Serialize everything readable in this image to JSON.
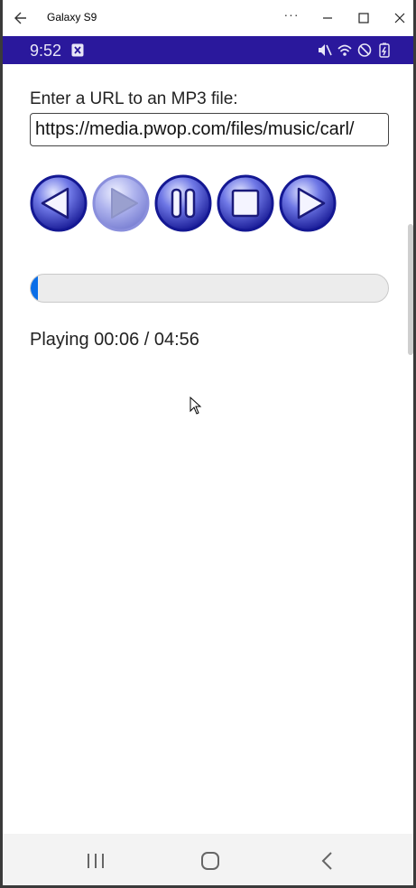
{
  "window": {
    "title": "Galaxy S9",
    "more_label": "···"
  },
  "statusbar": {
    "time": "9:52",
    "bg_color": "#2a189c"
  },
  "app": {
    "url_label": "Enter a URL to an MP3 file:",
    "url_value": "https://media.pwop.com/files/music/carl/",
    "controls": [
      {
        "name": "rewind-button",
        "icon": "rewind-icon",
        "enabled": true
      },
      {
        "name": "play-button",
        "icon": "play-icon",
        "enabled": false
      },
      {
        "name": "pause-button",
        "icon": "pause-icon",
        "enabled": true
      },
      {
        "name": "stop-button",
        "icon": "stop-icon",
        "enabled": true
      },
      {
        "name": "forward-button",
        "icon": "forward-icon",
        "enabled": true
      }
    ],
    "progress_fraction": 0.02,
    "accent_color": "#0a6ee8",
    "status_text": "Playing 00:06 / 04:56"
  },
  "navbar": {
    "recent_icon": "recent-apps-icon",
    "home_icon": "home-icon",
    "back_icon": "back-icon"
  }
}
